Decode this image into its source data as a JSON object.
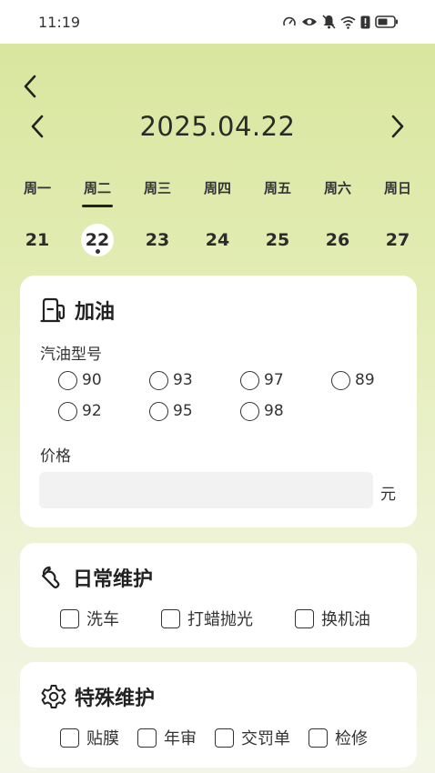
{
  "status": {
    "time": "11:19"
  },
  "date": {
    "title": "2025.04.22"
  },
  "week": {
    "days": [
      "周一",
      "周二",
      "周三",
      "周四",
      "周五",
      "周六",
      "周日"
    ],
    "dates": [
      "21",
      "22",
      "23",
      "24",
      "25",
      "26",
      "27"
    ],
    "selected_index": 1
  },
  "fuel": {
    "title": "加油",
    "type_label": "汽油型号",
    "options": [
      "90",
      "93",
      "97",
      "89",
      "92",
      "95",
      "98"
    ],
    "price_label": "价格",
    "price_value": "",
    "price_unit": "元"
  },
  "daily": {
    "title": "日常维护",
    "items": [
      "洗车",
      "打蜡抛光",
      "换机油"
    ]
  },
  "special": {
    "title": "特殊维护",
    "items": [
      "贴膜",
      "年审",
      "交罚单",
      "检修"
    ]
  },
  "colors": {
    "bg_top": "#d7e59a",
    "bg_bottom": "#f3f6e6",
    "card": "#ffffff",
    "input": "#f2f2f2"
  }
}
